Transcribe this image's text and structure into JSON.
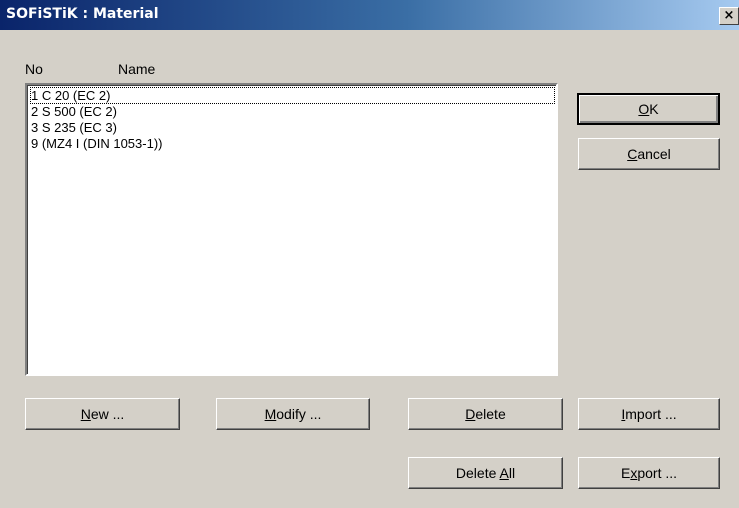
{
  "window": {
    "title": "SOFiSTiK : Material",
    "close_label": "×"
  },
  "list": {
    "headers": {
      "no": "No",
      "name": "Name"
    },
    "items": [
      {
        "label": "1 C 20 (EC 2)"
      },
      {
        "label": "2 S 500 (EC 2)"
      },
      {
        "label": "3 S 235 (EC 3)"
      },
      {
        "label": "9 (MZ4 I (DIN 1053-1))"
      }
    ]
  },
  "buttons": {
    "ok": {
      "access_key": "O",
      "rest": "K"
    },
    "cancel": {
      "access_key": "C",
      "rest": "ancel"
    },
    "new": {
      "access_key": "N",
      "rest": "ew ..."
    },
    "modify": {
      "access_key": "M",
      "rest": "odify ..."
    },
    "delete": {
      "access_key": "D",
      "rest": "elete"
    },
    "import": {
      "access_key": "I",
      "rest": "mport ..."
    },
    "delete_all": {
      "before": "Delete ",
      "access_key": "A",
      "rest": "ll"
    },
    "export": {
      "before": "E",
      "access_key": "x",
      "rest": "port ..."
    }
  }
}
